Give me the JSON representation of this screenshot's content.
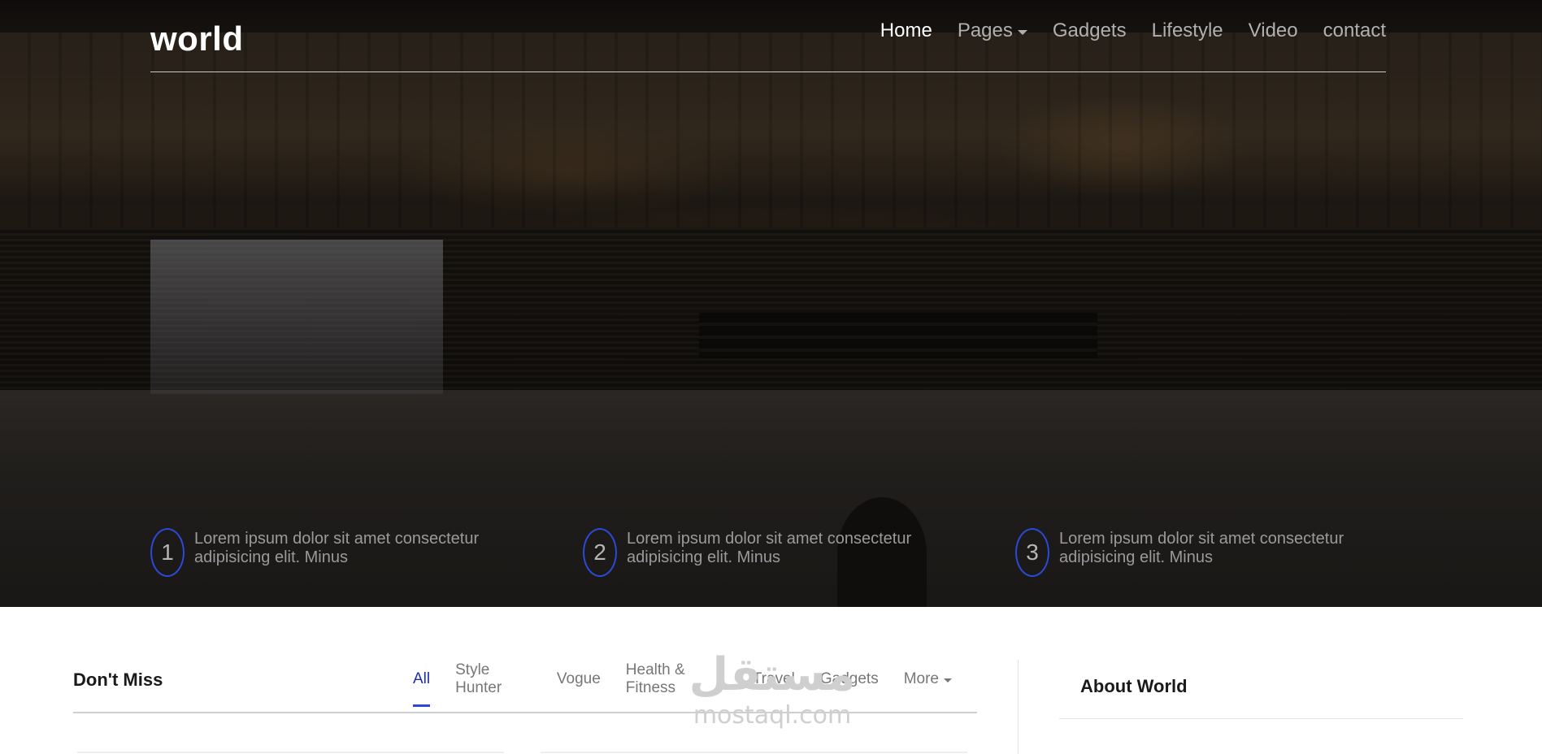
{
  "site": {
    "logo": "world"
  },
  "nav": {
    "items": [
      {
        "label": "Home",
        "active": true,
        "dropdown": false
      },
      {
        "label": "Pages",
        "active": false,
        "dropdown": true
      },
      {
        "label": "Gadgets",
        "active": false,
        "dropdown": false
      },
      {
        "label": "Lifestyle",
        "active": false,
        "dropdown": false
      },
      {
        "label": "Video",
        "active": false,
        "dropdown": false
      },
      {
        "label": "contact",
        "active": false,
        "dropdown": false
      }
    ]
  },
  "features": [
    {
      "number": "1",
      "text": "Lorem ipsum dolor sit amet consectetur adipisicing elit. Minus"
    },
    {
      "number": "2",
      "text": "Lorem ipsum dolor sit amet consectetur adipisicing elit. Minus"
    },
    {
      "number": "3",
      "text": "Lorem ipsum dolor sit amet consectetur adipisicing elit. Minus"
    }
  ],
  "dont_miss": {
    "title": "Don't Miss",
    "tabs": [
      {
        "label": "All",
        "active": true
      },
      {
        "label": "Style Hunter"
      },
      {
        "label": "Vogue"
      },
      {
        "label": "Health & Fitness"
      },
      {
        "label": "Travel"
      },
      {
        "label": "Gadgets"
      },
      {
        "label": "More",
        "dropdown": true
      }
    ]
  },
  "about": {
    "title": "About World"
  },
  "watermark": {
    "arabic": "مستقل",
    "latin": "mostaql.com"
  },
  "colors": {
    "accent": "#2b49d6",
    "nav_active": "#ffffff",
    "nav_inactive": "#b0b0b0"
  }
}
